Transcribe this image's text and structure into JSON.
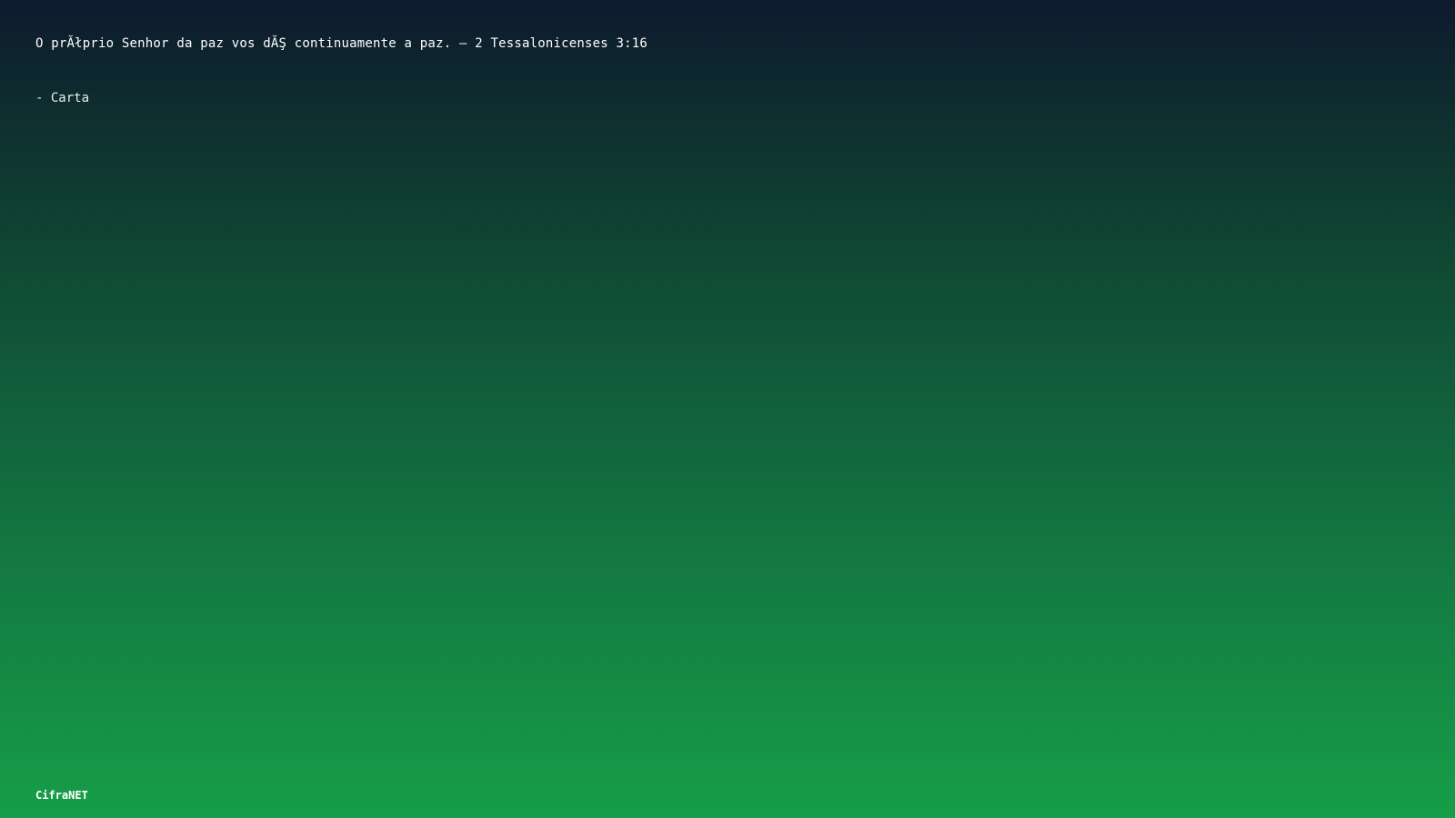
{
  "quote": {
    "text": "O prĂłprio Senhor da paz vos dĂŞ continuamente a paz. — 2 Tessalonicenses 3:16",
    "attribution": "- Carta"
  },
  "brand": {
    "name": "CifraNET"
  },
  "colors": {
    "gradient_top": "#0e1a2e",
    "gradient_bottom": "#169e48",
    "text": "#ffffff"
  }
}
